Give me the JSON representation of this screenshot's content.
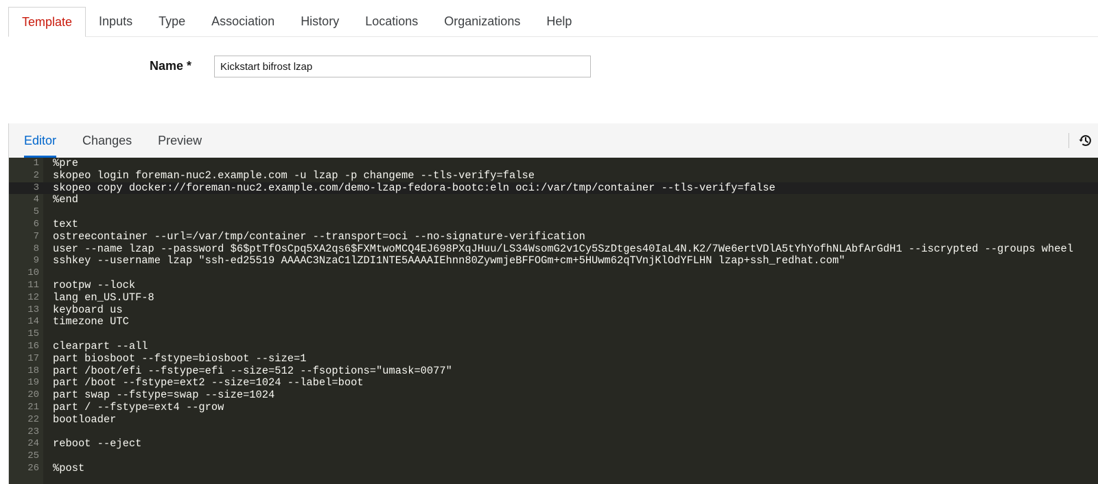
{
  "top_tabs": [
    {
      "label": "Template",
      "active": true
    },
    {
      "label": "Inputs"
    },
    {
      "label": "Type"
    },
    {
      "label": "Association"
    },
    {
      "label": "History"
    },
    {
      "label": "Locations"
    },
    {
      "label": "Organizations"
    },
    {
      "label": "Help"
    }
  ],
  "name_field": {
    "label": "Name *",
    "value": "Kickstart bifrost lzap"
  },
  "editor_tabs": [
    {
      "label": "Editor",
      "active": true
    },
    {
      "label": "Changes"
    },
    {
      "label": "Preview"
    }
  ],
  "toolbar": {
    "history_icon": "history-icon"
  },
  "colors": {
    "active_top_tab": "#c9190b",
    "active_editor_tab": "#0066cc",
    "code_background": "#272822"
  },
  "code": {
    "active_line": 3,
    "lines": [
      "%pre",
      "skopeo login foreman-nuc2.example.com -u lzap -p changeme --tls-verify=false",
      "skopeo copy docker://foreman-nuc2.example.com/demo-lzap-fedora-bootc:eln oci:/var/tmp/container --tls-verify=false",
      "%end",
      "",
      "text",
      "ostreecontainer --url=/var/tmp/container --transport=oci --no-signature-verification",
      "user --name lzap --password $6$ptTfOsCpq5XA2qs6$FXMtwoMCQ4EJ698PXqJHuu/LS34WsomG2v1Cy5SzDtges40IaL4N.K2/7We6ertVDlA5tYhYofhNLAbfArGdH1 --iscrypted --groups wheel",
      "sshkey --username lzap \"ssh-ed25519 AAAAC3NzaC1lZDI1NTE5AAAAIEhnn80ZywmjeBFFOGm+cm+5HUwm62qTVnjKlOdYFLHN lzap+ssh_redhat.com\"",
      "",
      "rootpw --lock",
      "lang en_US.UTF-8",
      "keyboard us",
      "timezone UTC",
      "",
      "clearpart --all",
      "part biosboot --fstype=biosboot --size=1",
      "part /boot/efi --fstype=efi --size=512 --fsoptions=\"umask=0077\"",
      "part /boot --fstype=ext2 --size=1024 --label=boot",
      "part swap --fstype=swap --size=1024",
      "part / --fstype=ext4 --grow",
      "bootloader",
      "",
      "reboot --eject",
      "",
      "%post"
    ]
  }
}
